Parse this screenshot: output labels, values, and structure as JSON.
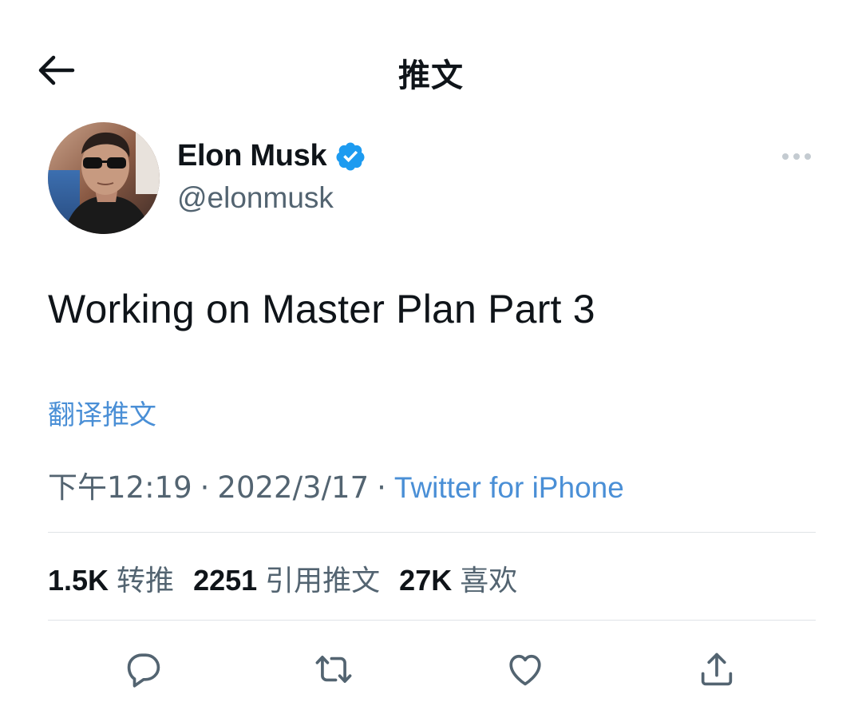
{
  "header": {
    "title": "推文",
    "back_icon": "arrow-left-icon"
  },
  "author": {
    "name": "Elon Musk",
    "handle": "@elonmusk",
    "verified": true,
    "verified_color": "#1d9bf0"
  },
  "more_icon": "more-horizontal-icon",
  "tweet": {
    "text": "Working on Master Plan Part 3",
    "translate_label": "翻译推文"
  },
  "meta": {
    "time": "下午12:19",
    "separator": "·",
    "date": "2022/3/17",
    "source": "Twitter for iPhone"
  },
  "stats": {
    "retweets": {
      "count": "1.5K",
      "label": "转推"
    },
    "quotes": {
      "count": "2251",
      "label": "引用推文"
    },
    "likes": {
      "count": "27K",
      "label": "喜欢"
    }
  },
  "actions": [
    {
      "icon": "reply-icon"
    },
    {
      "icon": "retweet-icon"
    },
    {
      "icon": "like-icon"
    },
    {
      "icon": "share-icon"
    }
  ],
  "colors": {
    "text_primary": "#0f1419",
    "text_secondary": "#536471",
    "link": "#4a8fd6",
    "divider": "#dfe3e7"
  }
}
